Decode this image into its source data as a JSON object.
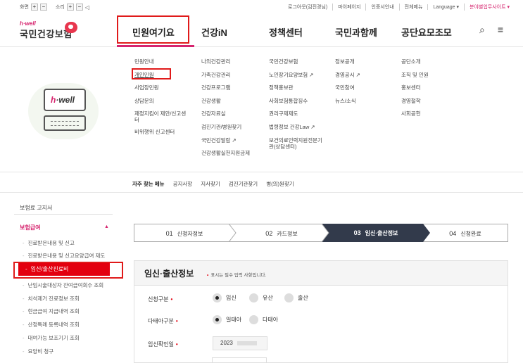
{
  "utility": {
    "screen_label": "화면",
    "sound_label": "소리",
    "plus": "+",
    "minus": "−",
    "speaker_icon": "speaker-icon",
    "links": [
      "로그아웃(김진경님)",
      "마이페이지",
      "인증서안내",
      "전체메뉴",
      "Language ▾"
    ],
    "branch_site": "분야별업무사이트 ▾"
  },
  "logo": {
    "small": "h·well",
    "name": "국민건강보험"
  },
  "gnb": [
    "민원여기요",
    "건강iN",
    "정책센터",
    "국민과함께",
    "공단요모조모"
  ],
  "header_icons": {
    "search": "⌕",
    "menu": "≡"
  },
  "mega_menu": {
    "col1": [
      "민원안내",
      "개인민원",
      "사업장민원",
      "상담문의",
      "재정지킴이 제안/신고센터",
      "비위행위 신고센터"
    ],
    "col2": [
      "나의건강관리",
      "가족건강관리",
      "건강프로그램",
      "건강생활",
      "건강자료실",
      "검진기관/병원찾기",
      "국민건강알람 ↗",
      "건강생활실천지원금제"
    ],
    "col3": [
      "국민건강보험",
      "노인장기요양보험 ↗",
      "정책홍보관",
      "사회보험통합징수",
      "권리구제제도",
      "법령정보 건강Law ↗",
      "보건의료인력지원전문기관(상담센터)"
    ],
    "col4": [
      "정보공개",
      "경영공시 ↗",
      "국민참여",
      "뉴스/소식"
    ],
    "col5": [
      "공단소개",
      "조직 및 인원",
      "홍보센터",
      "경영철학",
      "사회공헌"
    ]
  },
  "hwell_illustration": {
    "text_h": "h",
    "text_rest": "·well"
  },
  "favorites": {
    "title": "자주 찾는 메뉴",
    "items": [
      "공지사항",
      "지사찾기",
      "검진기관찾기",
      "병(의)원찾기"
    ]
  },
  "left_nav": {
    "top_item": "보험료 고지서",
    "section": "보험급여",
    "caret": "▲",
    "items": [
      "진료받은내용 및 신고",
      "진료받은내용 및 신고요양급여 제도"
    ],
    "active": "임신/출산진료비",
    "items_after": [
      "난임시술대상자 잔여급여회수 조회",
      "치석제거 진료정보 조회",
      "현금급여 지급내역 조회",
      "산정특례 등록내역 조회",
      "대여가능 보조기기 조회",
      "요양비 청구"
    ]
  },
  "steps": [
    {
      "num": "01",
      "label": "신청자정보"
    },
    {
      "num": "02",
      "label": "카드정보"
    },
    {
      "num": "03",
      "label": "임신·출산정보"
    },
    {
      "num": "04",
      "label": "신청완료"
    }
  ],
  "form": {
    "title": "임신·출산정보",
    "required_note": "표시는 필수 입력 사항입니다.",
    "required_mark": "•",
    "fields": {
      "pregnancy_type": {
        "label": "신청구분",
        "options": [
          "임신",
          "유산",
          "출산"
        ],
        "selected": "임신"
      },
      "fetus_type": {
        "label": "다태아구분",
        "options": [
          "일태아",
          "다태아"
        ],
        "selected": "일태아"
      },
      "confirm_date": {
        "label": "임신확인일",
        "value": "2023"
      }
    }
  },
  "colors": {
    "brand_pink": "#d6246e",
    "highlight_red": "#e3000f",
    "step_active": "#323a4b"
  }
}
